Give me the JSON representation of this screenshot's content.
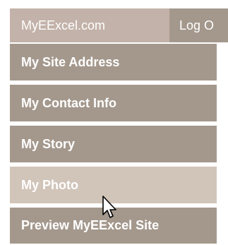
{
  "header": {
    "brand_label": "MyEExcel.com",
    "logout_label": "Log O"
  },
  "menu": {
    "items": [
      {
        "label": "My Site Address"
      },
      {
        "label": "My Contact Info"
      },
      {
        "label": "My Story"
      },
      {
        "label": "My Photo"
      },
      {
        "label": "Preview MyEExcel Site"
      }
    ],
    "hovered_item": "My Photo"
  },
  "colors": {
    "tab_active_bg": "#c3b2a9",
    "tab_bg": "#a4988d",
    "menu_item_bg": "#a4988d",
    "menu_item_hover_bg": "#d1c4b9",
    "text": "#ffffff"
  },
  "cursor": {
    "icon": "mouse-pointer-icon"
  }
}
